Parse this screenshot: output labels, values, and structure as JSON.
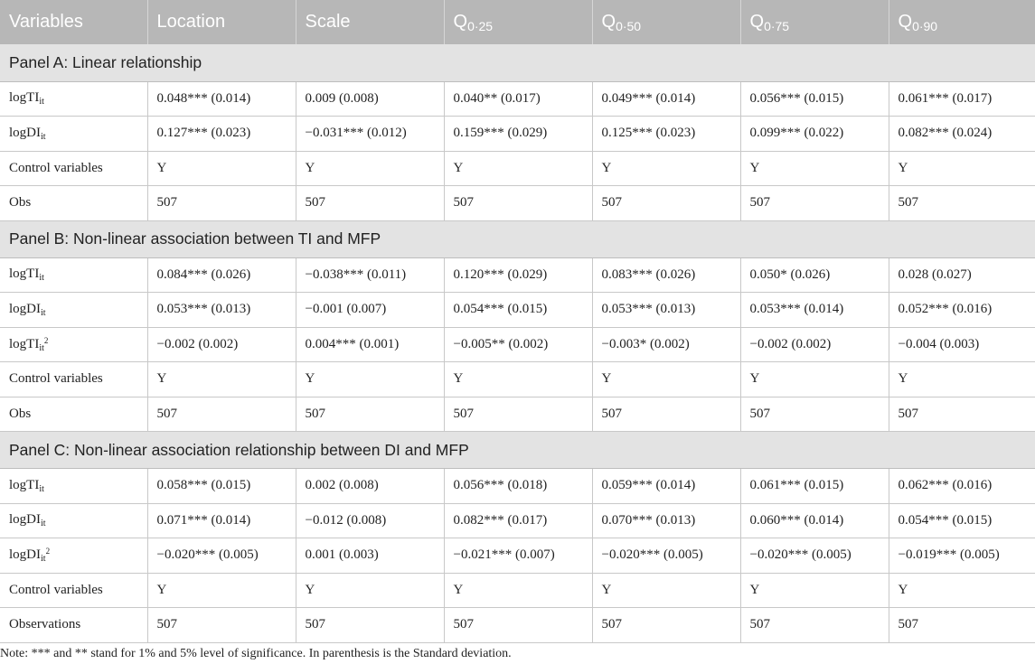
{
  "header": {
    "variables": "Variables",
    "location": "Location",
    "scale": "Scale",
    "q": "Q",
    "q1_sub": "0·25",
    "q2_sub": "0·50",
    "q3_sub": "0·75",
    "q4_sub": "0·90"
  },
  "vars": {
    "log": "log",
    "ti": "TI",
    "di": "DI",
    "it": "it",
    "sq": "2",
    "control": "Control variables",
    "obs": "Obs",
    "observations": "Observations"
  },
  "panels": [
    {
      "title": "Panel A: Linear relationship",
      "rows": [
        [
          "0.048*** (0.014)",
          "0.009 (0.008)",
          "0.040** (0.017)",
          "0.049*** (0.014)",
          "0.056*** (0.015)",
          "0.061*** (0.017)"
        ],
        [
          "0.127*** (0.023)",
          "−0.031*** (0.012)",
          "0.159*** (0.029)",
          "0.125*** (0.023)",
          "0.099*** (0.022)",
          "0.082*** (0.024)"
        ],
        [
          "Y",
          "Y",
          "Y",
          "Y",
          "Y",
          "Y"
        ],
        [
          "507",
          "507",
          "507",
          "507",
          "507",
          "507"
        ]
      ]
    },
    {
      "title": "Panel B: Non-linear association between TI and MFP",
      "rows": [
        [
          "0.084*** (0.026)",
          "−0.038*** (0.011)",
          "0.120*** (0.029)",
          "0.083*** (0.026)",
          "0.050* (0.026)",
          "0.028 (0.027)"
        ],
        [
          "0.053*** (0.013)",
          "−0.001 (0.007)",
          "0.054*** (0.015)",
          "0.053*** (0.013)",
          "0.053*** (0.014)",
          "0.052*** (0.016)"
        ],
        [
          "−0.002 (0.002)",
          "0.004*** (0.001)",
          "−0.005** (0.002)",
          "−0.003* (0.002)",
          "−0.002 (0.002)",
          "−0.004 (0.003)"
        ],
        [
          "Y",
          "Y",
          "Y",
          "Y",
          "Y",
          "Y"
        ],
        [
          "507",
          "507",
          "507",
          "507",
          "507",
          "507"
        ]
      ]
    },
    {
      "title": "Panel C: Non-linear association relationship between DI and MFP",
      "rows": [
        [
          "0.058*** (0.015)",
          "0.002 (0.008)",
          "0.056*** (0.018)",
          "0.059*** (0.014)",
          "0.061*** (0.015)",
          "0.062*** (0.016)"
        ],
        [
          "0.071*** (0.014)",
          "−0.012 (0.008)",
          "0.082*** (0.017)",
          "0.070*** (0.013)",
          "0.060*** (0.014)",
          "0.054*** (0.015)"
        ],
        [
          "−0.020*** (0.005)",
          "0.001 (0.003)",
          "−0.021*** (0.007)",
          "−0.020*** (0.005)",
          "−0.020*** (0.005)",
          "−0.019*** (0.005)"
        ],
        [
          "Y",
          "Y",
          "Y",
          "Y",
          "Y",
          "Y"
        ],
        [
          "507",
          "507",
          "507",
          "507",
          "507",
          "507"
        ]
      ]
    }
  ],
  "note": "Note: *** and ** stand for 1% and 5% level of significance. In parenthesis is the Standard deviation."
}
